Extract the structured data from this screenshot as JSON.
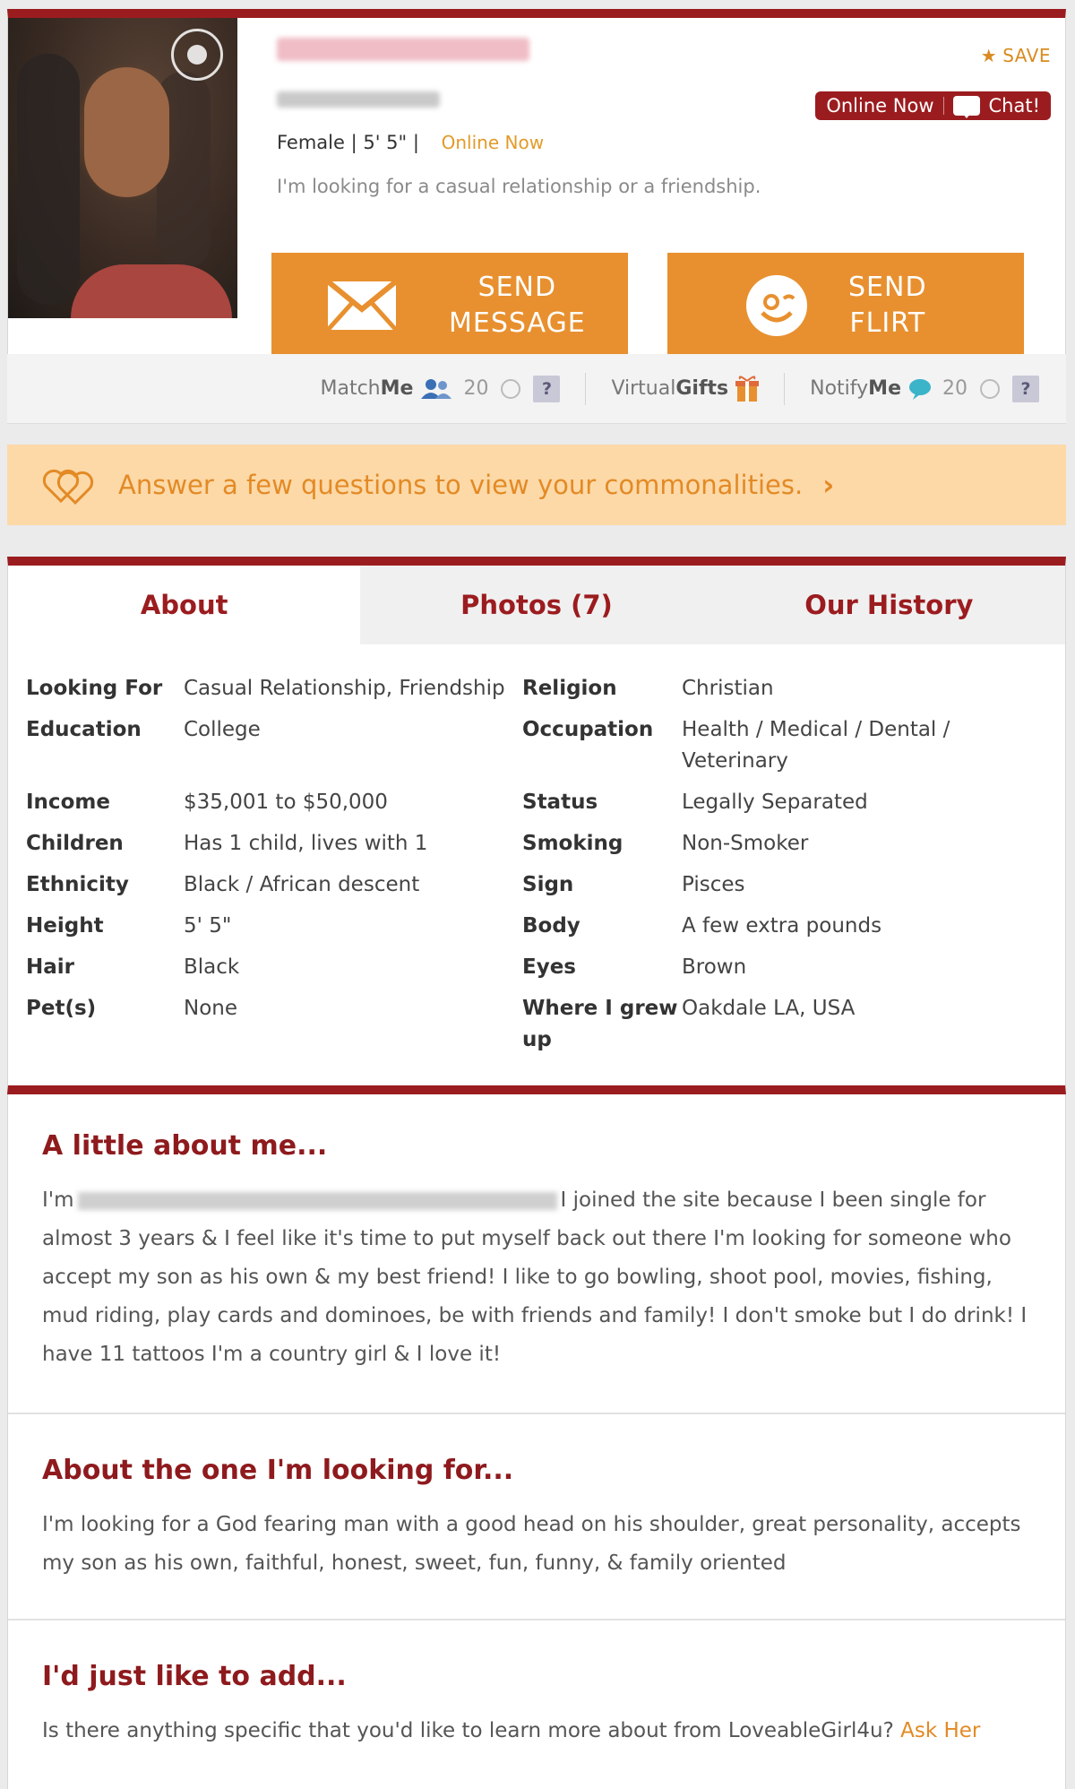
{
  "profile": {
    "save_label": "SAVE",
    "online_badge": "Online Now",
    "chat_label": "Chat!",
    "basics": "Female | 5' 5\" |",
    "online_status": "Online Now",
    "tagline": "I'm looking for a casual relationship or a friendship.",
    "send_message_line1": "SEND",
    "send_message_line2": "MESSAGE",
    "send_flirt_line1": "SEND",
    "send_flirt_line2": "FLIRT"
  },
  "features": {
    "matchme_prefix": "Match",
    "matchme_bold": "Me",
    "matchme_count": "20",
    "virtualgifts_prefix": "Virtual",
    "virtualgifts_bold": "Gifts",
    "notifyme_prefix": "Notify",
    "notifyme_bold": "Me",
    "notifyme_count": "20",
    "help": "?"
  },
  "banner": {
    "text": "Answer a few questions to view your commonalities."
  },
  "tabs": [
    {
      "label": "About"
    },
    {
      "label": "Photos (7)"
    },
    {
      "label": "Our History"
    }
  ],
  "attributes": {
    "left": [
      {
        "label": "Looking For",
        "value": "Casual Relationship, Friendship"
      },
      {
        "label": "Education",
        "value": "College"
      },
      {
        "label": "Income",
        "value": "$35,001 to $50,000"
      },
      {
        "label": "Children",
        "value": "Has 1 child, lives with 1"
      },
      {
        "label": "Ethnicity",
        "value": "Black / African descent"
      },
      {
        "label": "Height",
        "value": "5' 5\""
      },
      {
        "label": "Hair",
        "value": "Black"
      },
      {
        "label": "Pet(s)",
        "value": "None"
      }
    ],
    "right": [
      {
        "label": "Religion",
        "value": "Christian"
      },
      {
        "label": "Occupation",
        "value": "Health / Medical / Dental / Veterinary"
      },
      {
        "label": "Status",
        "value": "Legally Separated"
      },
      {
        "label": "Smoking",
        "value": "Non-Smoker"
      },
      {
        "label": "Sign",
        "value": "Pisces"
      },
      {
        "label": "Body",
        "value": "A few extra pounds"
      },
      {
        "label": "Eyes",
        "value": "Brown"
      },
      {
        "label": "Where I grew up",
        "value": "Oakdale LA, USA"
      }
    ]
  },
  "about_me": {
    "title": "A little about me...",
    "lead": "I'm",
    "body": "I joined the site because I been single for almost 3 years & I feel like it's time to put myself back out there I'm looking for someone who accept my son as his own & my best friend! I like to go bowling, shoot pool, movies, fishing, mud riding, play cards and dominoes, be with friends and family! I don't smoke but I do drink! I have 11 tattoos I'm a country girl & I love it!"
  },
  "looking_for": {
    "title": "About the one I'm looking for...",
    "body": "I'm looking for a God fearing man with a good head on his shoulder, great personality, accepts my son as his own, faithful, honest, sweet, fun, funny, & family oriented"
  },
  "add": {
    "title": "I'd just like to add...",
    "body": "Is there anything specific that you'd like to learn more about from LoveableGirl4u?",
    "ask_link": "Ask Her"
  },
  "colors": {
    "brand_red": "#9b1c1f",
    "brand_orange": "#e8902f",
    "banner_bg": "#fdd9a8"
  }
}
